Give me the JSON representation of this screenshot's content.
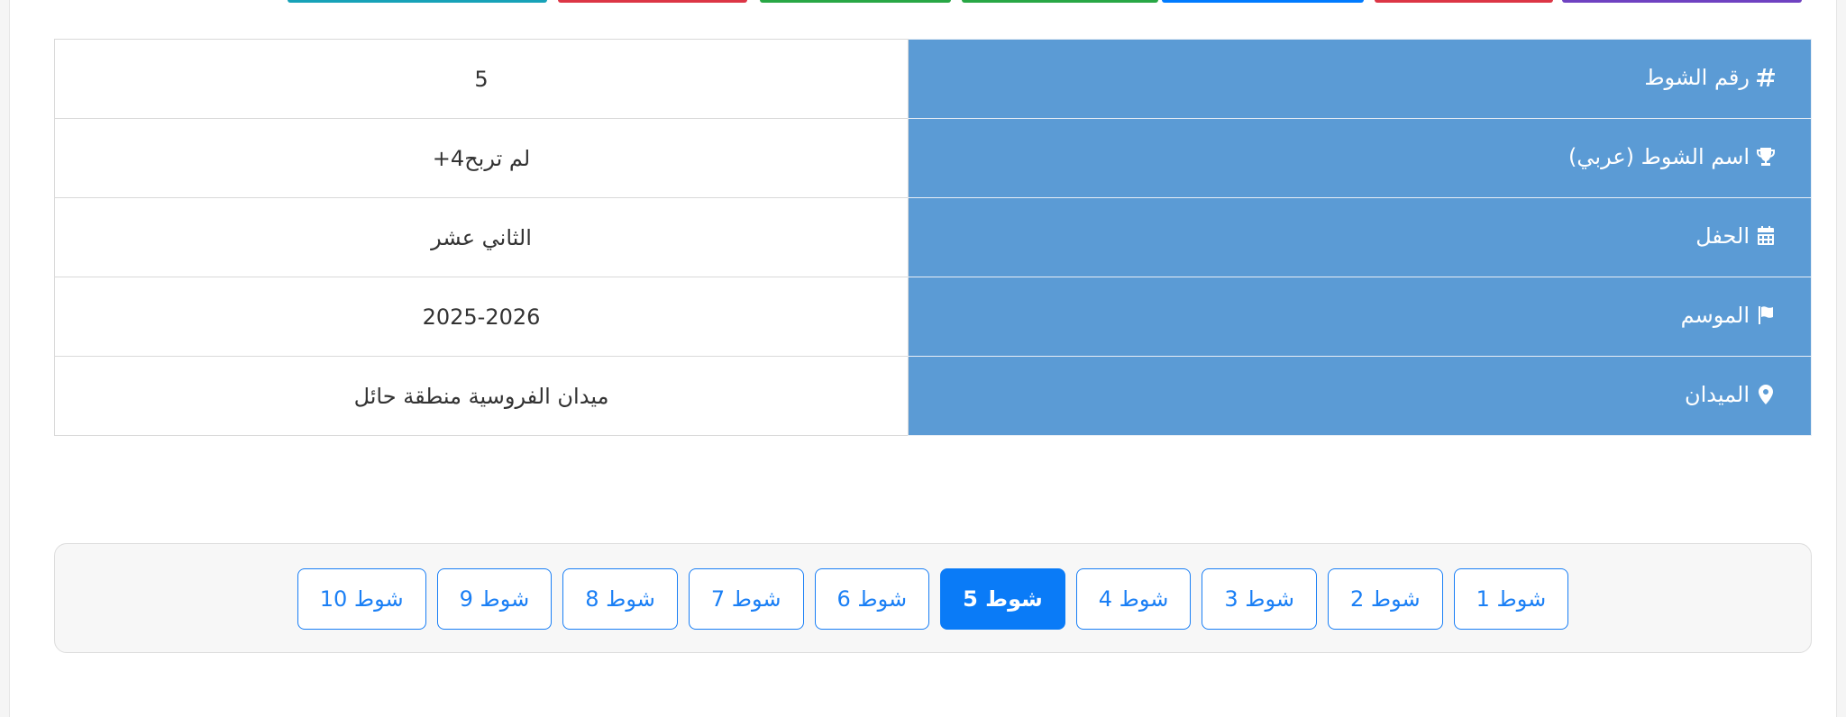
{
  "top_strips": [
    {
      "color": "#17a2b8"
    },
    {
      "color": "#dc3545"
    },
    {
      "color": "#28a745"
    },
    {
      "color": "#28a745"
    },
    {
      "color": "#007bff"
    },
    {
      "color": "#dc3545"
    },
    {
      "color": "#6f42c1"
    }
  ],
  "details": {
    "rows": [
      {
        "icon": "hashtag-icon",
        "label": "رقم الشوط",
        "value": "5"
      },
      {
        "icon": "trophy-icon",
        "label": "اسم الشوط (عربي)",
        "value": "لم تربح4+"
      },
      {
        "icon": "calendar-icon",
        "label": "الحفل",
        "value": "الثاني عشر"
      },
      {
        "icon": "flag-icon",
        "label": "الموسم",
        "value": "2025-2026"
      },
      {
        "icon": "map-marker-icon",
        "label": "الميدان",
        "value": "ميدان الفروسية منطقة حائل"
      }
    ],
    "label_bg": "#5b9bd5"
  },
  "pagination": {
    "active_index": 4,
    "items": [
      "شوط 1",
      "شوط 2",
      "شوط 3",
      "شوط 4",
      "شوط 5",
      "شوط 6",
      "شوط 7",
      "شوط 8",
      "شوط 9",
      "شوط 10"
    ],
    "accent": "#0a7bf7"
  }
}
